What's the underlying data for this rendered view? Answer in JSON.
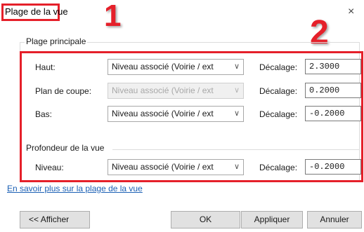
{
  "dialog": {
    "title": "Plage de la vue",
    "close_icon": "×"
  },
  "callouts": {
    "one": "1",
    "two": "2"
  },
  "main_range": {
    "group_label": "Plage principale",
    "rows": [
      {
        "label": "Haut:",
        "select_value": "Niveau associé (Voirie / ext ",
        "enabled": true,
        "offset_label": "Décalage:",
        "offset_value": "2.3000"
      },
      {
        "label": "Plan de coupe:",
        "select_value": "Niveau associé (Voirie / ext ",
        "enabled": false,
        "offset_label": "Décalage:",
        "offset_value": "0.2000"
      },
      {
        "label": "Bas:",
        "select_value": "Niveau associé (Voirie / ext ",
        "enabled": true,
        "offset_label": "Décalage:",
        "offset_value": "-0.2000"
      }
    ]
  },
  "view_depth": {
    "group_label": "Profondeur de la vue",
    "row": {
      "label": "Niveau:",
      "select_value": "Niveau associé (Voirie / ext ",
      "enabled": true,
      "offset_label": "Décalage:",
      "offset_value": "-0.2000"
    }
  },
  "help_link": "En savoir plus sur la plage de la vue",
  "buttons": {
    "show": "<< Afficher",
    "ok": "OK",
    "apply": "Appliquer",
    "cancel": "Annuler"
  },
  "colors": {
    "annotation_red": "#e5202a",
    "link_blue": "#1a5fb4"
  }
}
